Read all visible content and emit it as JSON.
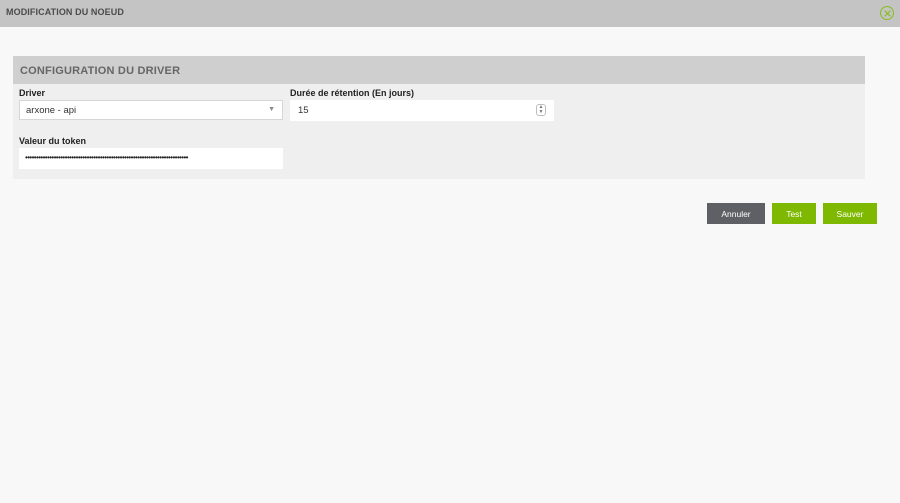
{
  "header": {
    "title": "MODIFICATION DU NOEUD",
    "close_icon": "close-circle-icon",
    "accent_color": "#86bd1e"
  },
  "section": {
    "title": "CONFIGURATION DU DRIVER"
  },
  "driver": {
    "label": "Driver",
    "value": "arxone - api"
  },
  "retention": {
    "label": "Durée de rétention (En jours)",
    "value": "15"
  },
  "token": {
    "label": "Valeur du token",
    "value": "••••••••••••••••••••••••••••••••••••••••••••••••••••••••••••••••••••••••••"
  },
  "actions": {
    "cancel_label": "Annuler",
    "test_label": "Test",
    "save_label": "Sauver"
  }
}
